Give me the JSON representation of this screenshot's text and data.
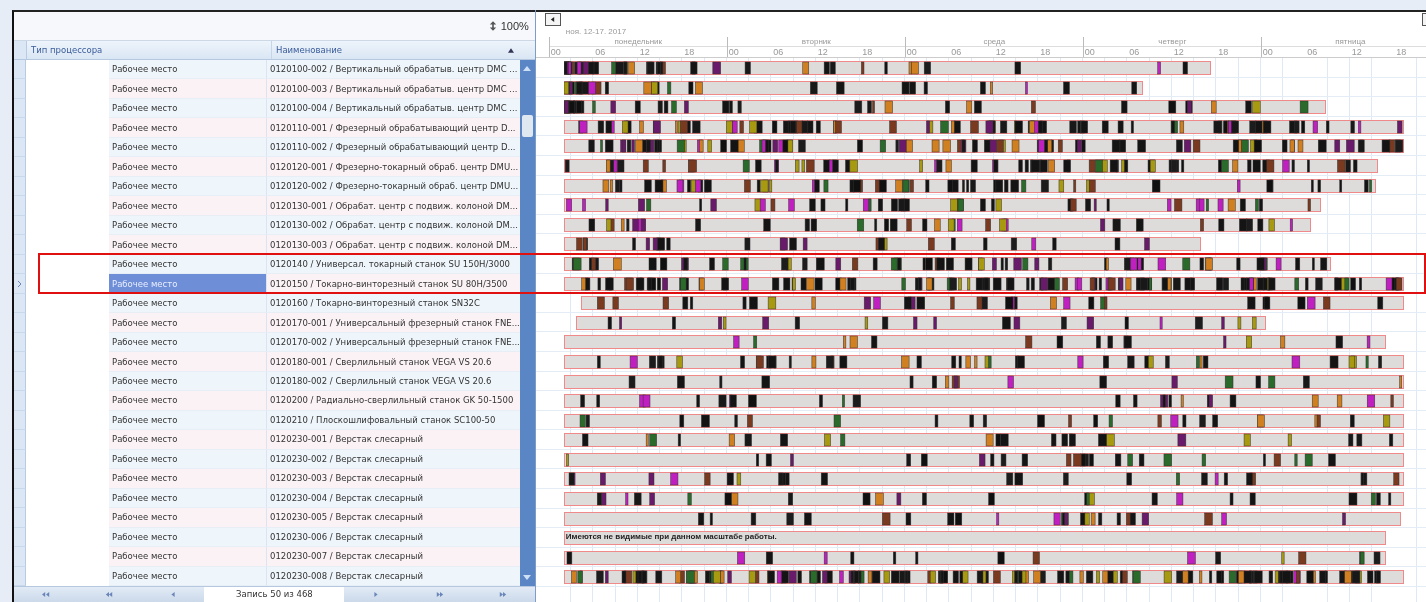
{
  "toolbar": {
    "zoom": "100%"
  },
  "table": {
    "columns": [
      {
        "label": "Тип процессора"
      },
      {
        "label": "Наименование",
        "sorted": true
      }
    ],
    "rows": [
      {
        "type": "Рабочее место",
        "name": "0120100-002 / Вертикальный обрабатыв. центр DMC ...",
        "selected": false,
        "framed": false
      },
      {
        "type": "Рабочее место",
        "name": "0120100-003 / Вертикальный обрабатыв. центр DMC ...",
        "selected": false,
        "framed": false
      },
      {
        "type": "Рабочее место",
        "name": "0120100-004 / Вертикальный обрабатыв. центр DMC ...",
        "selected": false,
        "framed": false
      },
      {
        "type": "Рабочее место",
        "name": "0120110-001 / Фрезерный обрабатывающий центр D...",
        "selected": false,
        "framed": false
      },
      {
        "type": "Рабочее место",
        "name": "0120110-002 / Фрезерный обрабатывающий центр D...",
        "selected": false,
        "framed": false
      },
      {
        "type": "Рабочее место",
        "name": "0120120-001 / Фрезерно-токарный обраб. центр DMU...",
        "selected": false,
        "framed": false
      },
      {
        "type": "Рабочее место",
        "name": "0120120-002 / Фрезерно-токарный обраб. центр DMU...",
        "selected": false,
        "framed": false
      },
      {
        "type": "Рабочее место",
        "name": "0120130-001 / Обрабат. центр с подвиж. колоной DM...",
        "selected": false,
        "framed": false
      },
      {
        "type": "Рабочее место",
        "name": "0120130-002 / Обрабат. центр с подвиж. колоной DM...",
        "selected": false,
        "framed": false
      },
      {
        "type": "Рабочее место",
        "name": "0120130-003 / Обрабат. центр с подвиж. колоной DM...",
        "selected": false,
        "framed": false
      },
      {
        "type": "Рабочее место",
        "name": "0120140 / Универсал. токарный станок SU 150H/3000",
        "selected": false,
        "framed": true
      },
      {
        "type": "Рабочее место",
        "name": "0120150 / Токарно-винторезный станок SU 80H/3500",
        "selected": true,
        "framed": true
      },
      {
        "type": "Рабочее место",
        "name": "0120160 / Токарно-винторезный станок SN32C",
        "selected": false,
        "framed": false
      },
      {
        "type": "Рабочее место",
        "name": "0120170-001 / Универсальный фрезерный станок FNE...",
        "selected": false,
        "framed": false
      },
      {
        "type": "Рабочее место",
        "name": "0120170-002 / Универсальный фрезерный станок FNE...",
        "selected": false,
        "framed": false
      },
      {
        "type": "Рабочее место",
        "name": "0120180-001 / Сверлильный станок VEGA VS 20.6",
        "selected": false,
        "framed": false
      },
      {
        "type": "Рабочее место",
        "name": "0120180-002 / Сверлильный станок VEGA VS 20.6",
        "selected": false,
        "framed": false
      },
      {
        "type": "Рабочее место",
        "name": "0120200 / Радиально-сверлильный станок GK 50-1500",
        "selected": false,
        "framed": false
      },
      {
        "type": "Рабочее место",
        "name": "0120210 / Плоскошлифовальный станок SC100-50",
        "selected": false,
        "framed": false
      },
      {
        "type": "Рабочее место",
        "name": "0120230-001 / Верстак слесарный",
        "selected": false,
        "framed": false
      },
      {
        "type": "Рабочее место",
        "name": "0120230-002 / Верстак слесарный",
        "selected": false,
        "framed": false
      },
      {
        "type": "Рабочее место",
        "name": "0120230-003 / Верстак слесарный",
        "selected": false,
        "framed": false
      },
      {
        "type": "Рабочее место",
        "name": "0120230-004 / Верстак слесарный",
        "selected": false,
        "framed": false
      },
      {
        "type": "Рабочее место",
        "name": "0120230-005 / Верстак слесарный",
        "selected": false,
        "framed": false
      },
      {
        "type": "Рабочее место",
        "name": "0120230-006 / Верстак слесарный",
        "selected": false,
        "framed": false,
        "gantt_note": "Имеются не видимые при данном масштабе работы."
      },
      {
        "type": "Рабочее место",
        "name": "0120230-007 / Верстак слесарный",
        "selected": false,
        "framed": false
      },
      {
        "type": "Рабочее место",
        "name": "0120230-008 / Верстак слесарный",
        "selected": false,
        "framed": false
      }
    ]
  },
  "pager": {
    "label": "Запись 50 из 468"
  },
  "gantt": {
    "period": "ноя. 12-17. 2017",
    "days": [
      {
        "name": "понедельник",
        "hours": [
          "00",
          "06",
          "12",
          "18"
        ]
      },
      {
        "name": "вторник",
        "hours": [
          "00",
          "06",
          "12",
          "18"
        ]
      },
      {
        "name": "среда",
        "hours": [
          "00",
          "06",
          "12",
          "18"
        ]
      },
      {
        "name": "четверг",
        "hours": [
          "00",
          "06",
          "12",
          "18"
        ]
      },
      {
        "name": "пятница",
        "hours": [
          "00",
          "06",
          "12",
          "18"
        ]
      }
    ]
  }
}
